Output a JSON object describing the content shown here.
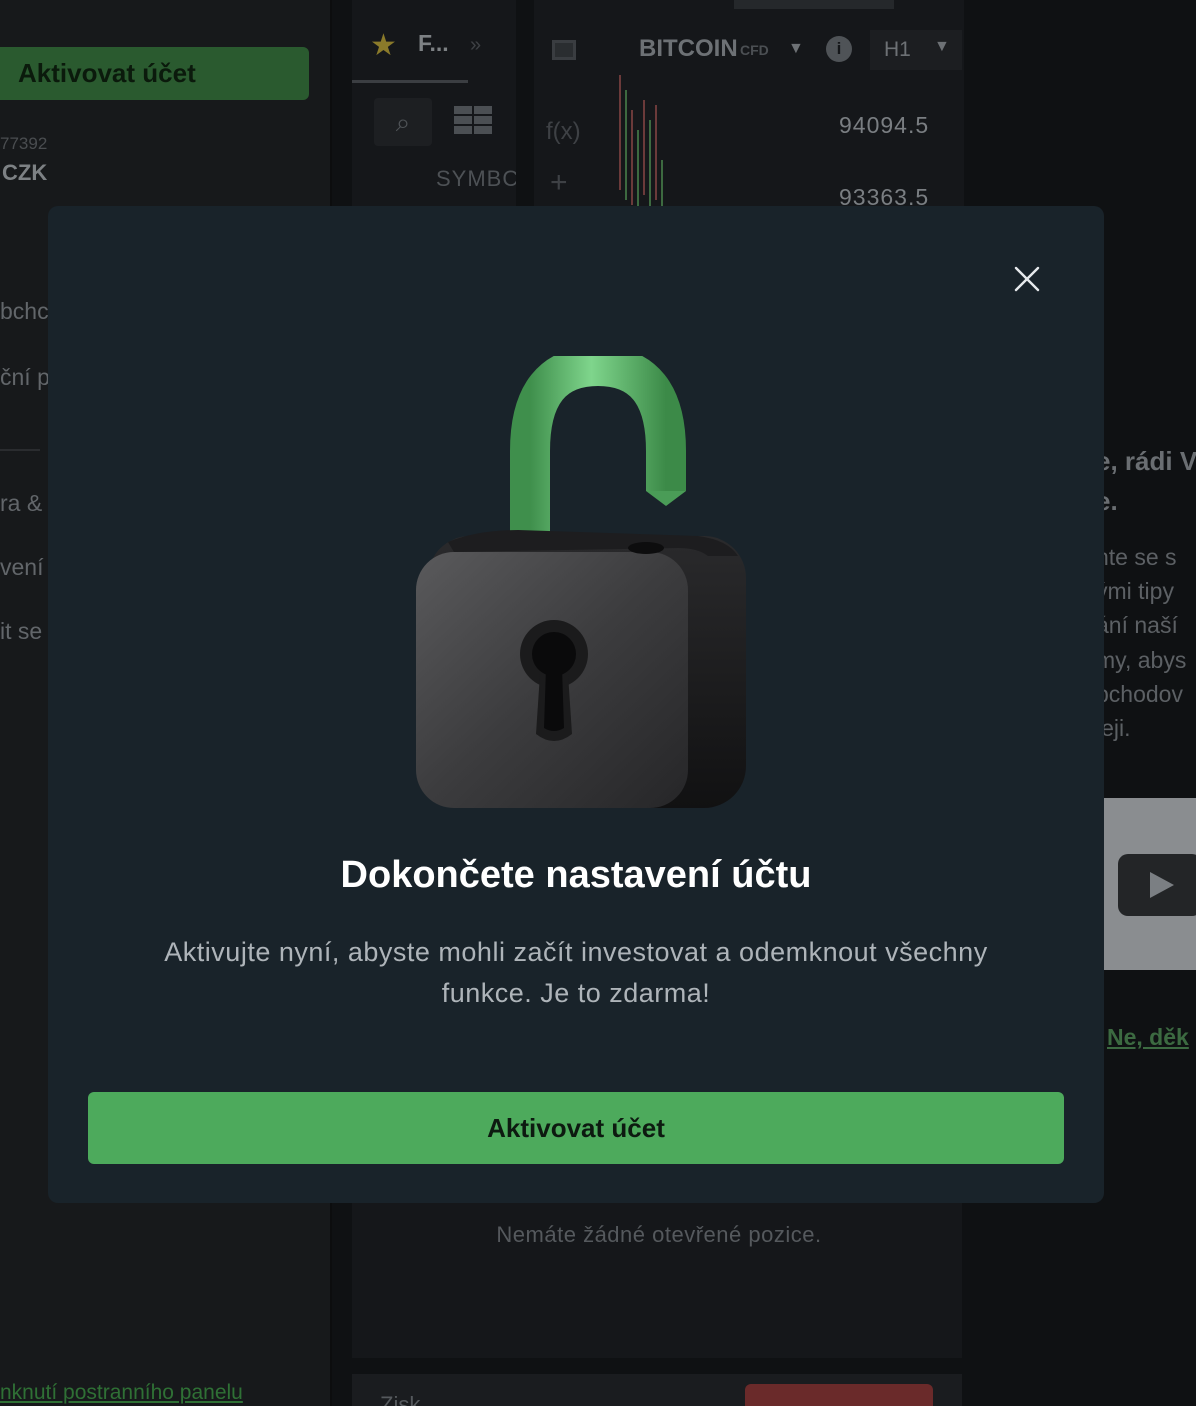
{
  "sidebar": {
    "activate_label": "Aktivovat účet",
    "account_number": "77392",
    "currency": "CZK",
    "items": [
      "bchc",
      "ční p",
      "ra &",
      "vení",
      "it se"
    ],
    "collapse_link": "nknutí postranního panelu"
  },
  "watchlist": {
    "tab_label": "F...",
    "column_symbol": "SYMBC"
  },
  "chart": {
    "symbol": "BITCOIN",
    "instrument_type": "CFD",
    "info_glyph": "i",
    "timeframe": "H1",
    "fx_label": "f(x)",
    "price_high": "94094.5",
    "price_low": "93363.5"
  },
  "promo": {
    "heading_lines": [
      "e, rádi V",
      "e."
    ],
    "body_lines": [
      "nte se s",
      "ými tipy",
      "ání naší",
      "my, abys",
      "bchodov",
      "leji."
    ],
    "decline_link": "Ne, děk"
  },
  "positions": {
    "empty_text": "Nemáte žádné otevřené pozice.",
    "pnl_label": "Zisk"
  },
  "modal": {
    "title": "Dokončete nastavení účtu",
    "description": "Aktivujte nyní, abyste mohli začít investovat a odemknout všechny funkce. Je to zdarma!",
    "cta_label": "Aktivovat účet",
    "colors": {
      "background": "#19232a",
      "cta": "#4daa5c",
      "shackle": "#5cb86a"
    }
  }
}
